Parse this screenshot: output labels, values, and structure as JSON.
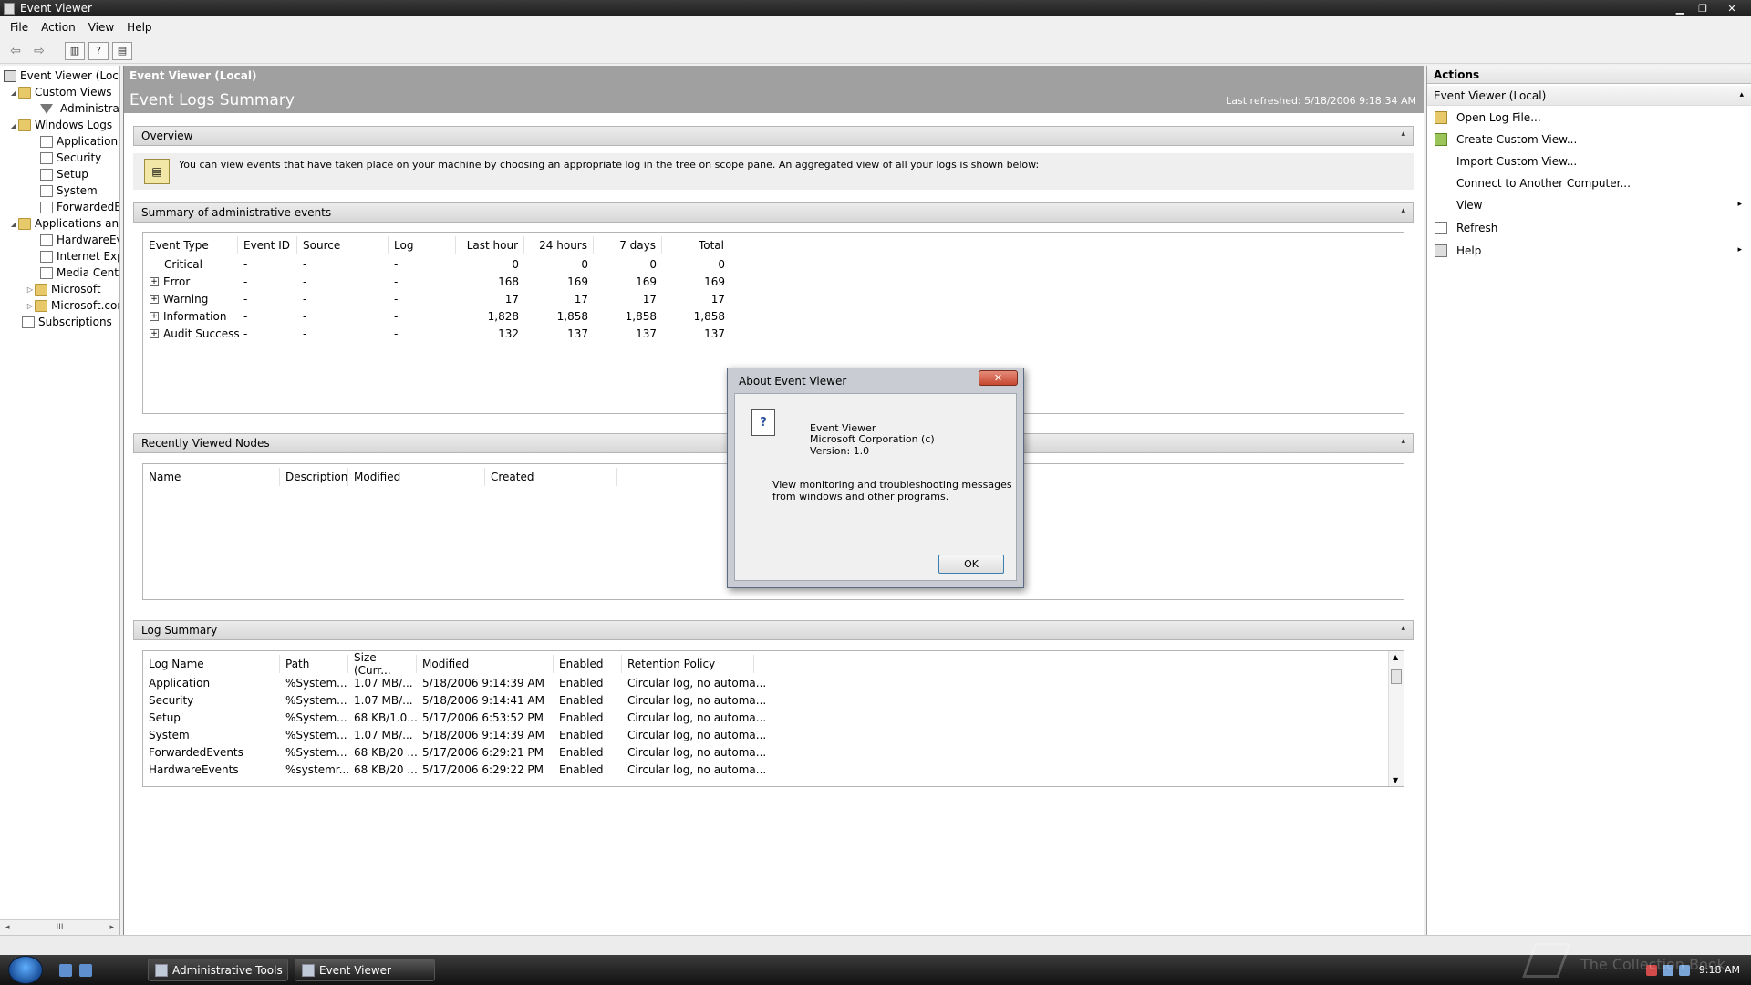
{
  "window": {
    "title": "Event Viewer",
    "minimize_glyph": "▁",
    "restore_glyph": "❐",
    "close_glyph": "✕"
  },
  "menu": [
    "File",
    "Action",
    "View",
    "Help"
  ],
  "toolbar": {
    "back_glyph": "⇦",
    "forward_glyph": "⇨"
  },
  "tree": {
    "root": "Event Viewer (Local)",
    "custom_views": "Custom Views",
    "administrative": "Administrative Events",
    "windows_logs": "Windows Logs",
    "application": "Application",
    "security": "Security",
    "setup": "Setup",
    "system": "System",
    "forwarded": "ForwardedEvents",
    "apps_services": "Applications and Services Logs",
    "hardware": "HardwareEvents",
    "internet": "Internet Explorer",
    "media": "Media Center",
    "microsoft": "Microsoft",
    "microsoft_co": "Microsoft.com",
    "subscriptions": "Subscriptions",
    "scroll_left": "◂",
    "scroll_thumb": "III",
    "scroll_right": "▸"
  },
  "center": {
    "breadcrumb": "Event Viewer (Local)",
    "title": "Event Logs Summary",
    "last_refreshed": "Last refreshed: 5/18/2006 9:18:34 AM",
    "overview": {
      "heading": "Overview",
      "text": "You can view events that have taken place on your machine by choosing an appropriate log in the tree on scope pane. An aggregated view of all your logs is shown below:"
    },
    "summary": {
      "heading": "Summary of administrative events",
      "columns": [
        "Event Type",
        "Event ID",
        "Source",
        "Log",
        "Last hour",
        "24 hours",
        "7 days",
        "Total"
      ],
      "rows": [
        {
          "type": "Critical",
          "id": "-",
          "source": "-",
          "log": "-",
          "hour": "0",
          "day": "0",
          "week": "0",
          "total": "0"
        },
        {
          "type": "Error",
          "id": "-",
          "source": "-",
          "log": "-",
          "hour": "168",
          "day": "169",
          "week": "169",
          "total": "169"
        },
        {
          "type": "Warning",
          "id": "-",
          "source": "-",
          "log": "-",
          "hour": "17",
          "day": "17",
          "week": "17",
          "total": "17"
        },
        {
          "type": "Information",
          "id": "-",
          "source": "-",
          "log": "-",
          "hour": "1,828",
          "day": "1,858",
          "week": "1,858",
          "total": "1,858"
        },
        {
          "type": "Audit Success",
          "id": "-",
          "source": "-",
          "log": "-",
          "hour": "132",
          "day": "137",
          "week": "137",
          "total": "137"
        }
      ]
    },
    "recent": {
      "heading": "Recently Viewed Nodes",
      "columns": [
        "Name",
        "Description",
        "Modified",
        "Created"
      ]
    },
    "log_summary": {
      "heading": "Log Summary",
      "columns": [
        "Log Name",
        "Path",
        "Size (Curr...",
        "Modified",
        "Enabled",
        "Retention Policy"
      ],
      "rows": [
        {
          "name": "Application",
          "path": "%System...",
          "size": "1.07 MB/...",
          "modified": "5/18/2006 9:14:39 AM",
          "enabled": "Enabled",
          "retention": "Circular log, no automa..."
        },
        {
          "name": "Security",
          "path": "%System...",
          "size": "1.07 MB/...",
          "modified": "5/18/2006 9:14:41 AM",
          "enabled": "Enabled",
          "retention": "Circular log, no automa..."
        },
        {
          "name": "Setup",
          "path": "%System...",
          "size": "68 KB/1.0...",
          "modified": "5/17/2006 6:53:52 PM",
          "enabled": "Enabled",
          "retention": "Circular log, no automa..."
        },
        {
          "name": "System",
          "path": "%System...",
          "size": "1.07 MB/...",
          "modified": "5/18/2006 9:14:39 AM",
          "enabled": "Enabled",
          "retention": "Circular log, no automa..."
        },
        {
          "name": "ForwardedEvents",
          "path": "%System...",
          "size": "68 KB/20 ...",
          "modified": "5/17/2006 6:29:21 PM",
          "enabled": "Enabled",
          "retention": "Circular log, no automa..."
        },
        {
          "name": "HardwareEvents",
          "path": "%systemr...",
          "size": "68 KB/20 ...",
          "modified": "5/17/2006 6:29:22 PM",
          "enabled": "Enabled",
          "retention": "Circular log, no automa..."
        }
      ]
    },
    "expand_glyph": "+",
    "collapse_glyph": "▴",
    "scroll_up": "▲",
    "scroll_down": "▼"
  },
  "actions": {
    "title": "Actions",
    "section": "Event Viewer (Local)",
    "items": [
      "Open Log File...",
      "Create Custom View...",
      "Import Custom View...",
      "Connect to Another Computer...",
      "View",
      "Refresh",
      "Help"
    ],
    "submenu_glyph": "▸"
  },
  "dialog": {
    "title": "About Event Viewer",
    "close_glyph": "✕",
    "icon_glyph": "?",
    "app_name": "Event Viewer",
    "company": "Microsoft Corporation (c)",
    "version": "Version: 1.0",
    "desc_line1": "View monitoring and troubleshooting messages",
    "desc_line2": "from windows and other programs.",
    "ok": "OK"
  },
  "taskbar": {
    "tasks": [
      "Administrative Tools",
      "Event Viewer"
    ],
    "clock": "9:18 AM"
  },
  "watermark": "The Collection Book",
  "colors": {
    "header_gray": "#a0a0a0",
    "taskbar": "#1e1e1e",
    "dialog_frame": "#c9ccd2",
    "close_red": "#c64930"
  }
}
